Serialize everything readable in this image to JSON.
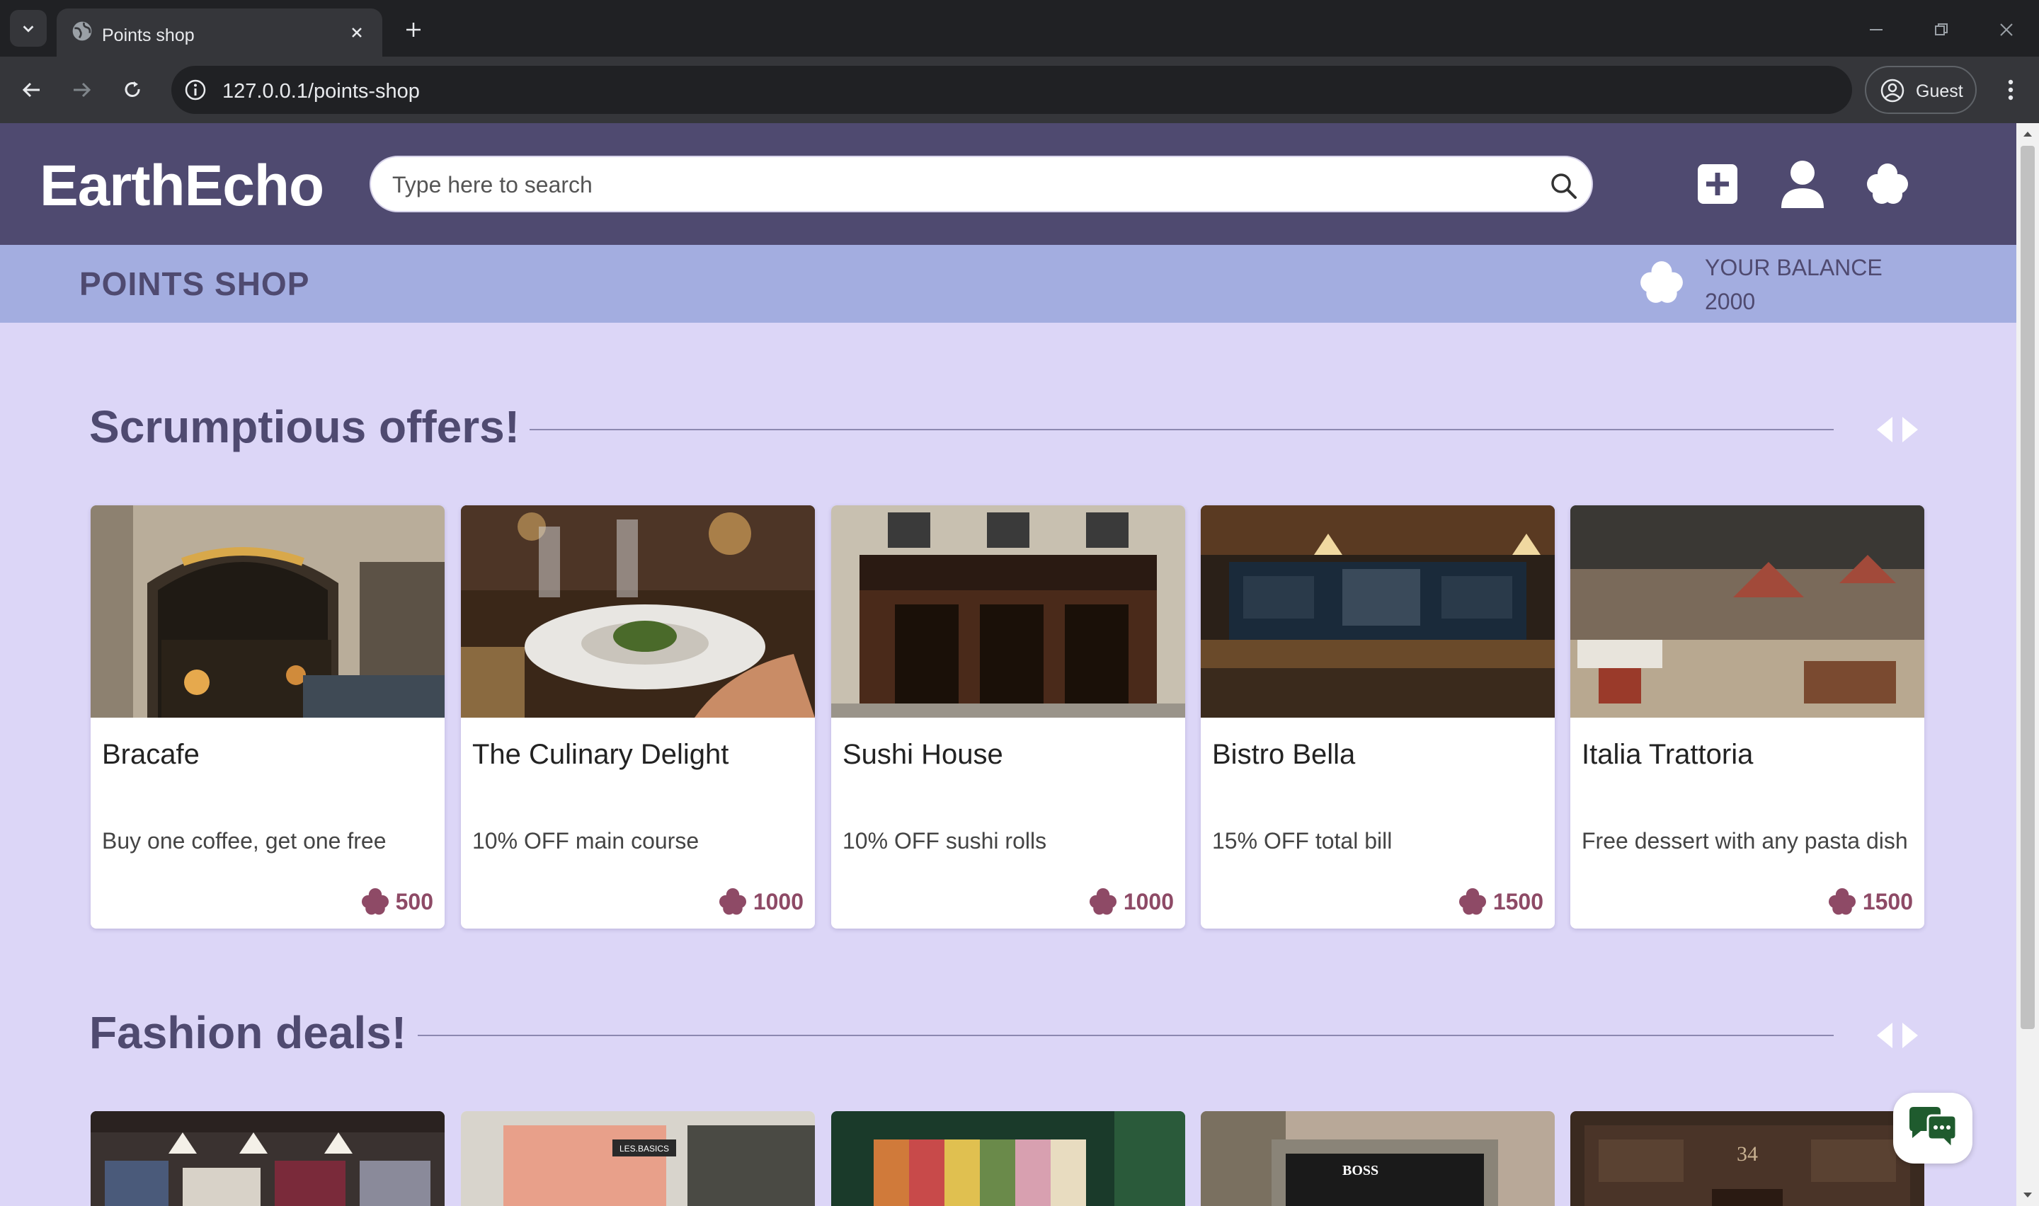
{
  "browser": {
    "tab_title": "Points shop",
    "url": "127.0.0.1/points-shop",
    "profile_label": "Guest"
  },
  "header": {
    "logo": "EarthEcho",
    "search_placeholder": "Type here to search",
    "icons": [
      "plus-square-icon",
      "user-icon",
      "clover-icon"
    ]
  },
  "subheader": {
    "title": "POINTS SHOP",
    "balance_label": "YOUR BALANCE",
    "balance_value": "2000"
  },
  "sections": [
    {
      "title": "Scrumptious offers!",
      "cards": [
        {
          "name": "Bracafe",
          "offer": "Buy one coffee, get one free",
          "points": "500",
          "image": "cafe-storefront"
        },
        {
          "name": "The Culinary Delight",
          "offer": "10% OFF main course",
          "points": "1000",
          "image": "restaurant-plate"
        },
        {
          "name": "Sushi House",
          "offer": "10% OFF sushi rolls",
          "points": "1000",
          "image": "sushi-storefront"
        },
        {
          "name": "Bistro Bella",
          "offer": "15% OFF total bill",
          "points": "1500",
          "image": "bar-interior"
        },
        {
          "name": "Italia Trattoria",
          "offer": "Free dessert with any pasta dish",
          "points": "1500",
          "image": "trattoria-interior"
        }
      ]
    },
    {
      "title": "Fashion deals!",
      "cards": [
        {
          "image": "clothing-store"
        },
        {
          "image": "les-basics-storefront",
          "sign": "LES.BASICS"
        },
        {
          "image": "stussy-clothing-rack"
        },
        {
          "image": "boss-storefront",
          "sign": "BOSS"
        },
        {
          "image": "denim-store",
          "sign": "34"
        }
      ]
    }
  ],
  "colors": {
    "header_bg": "#4f4a70",
    "subheader_bg": "#a3ade0",
    "page_bg": "#dcd6f7",
    "points_color": "#8e4a66"
  }
}
